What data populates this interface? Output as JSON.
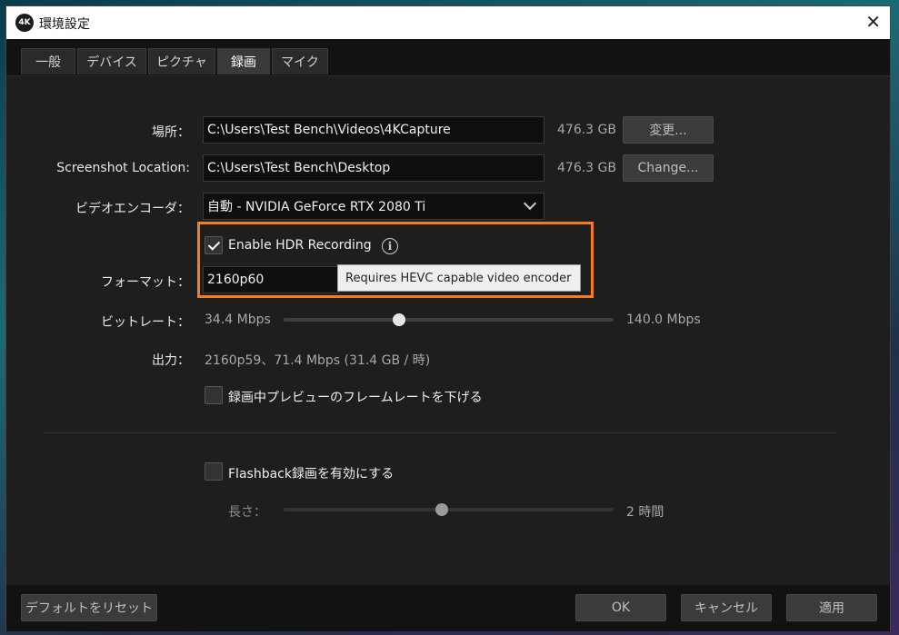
{
  "window": {
    "title": "環境設定",
    "app_icon_text": "4K",
    "close_glyph": "✕"
  },
  "tabs": [
    {
      "label": "一般"
    },
    {
      "label": "デバイス"
    },
    {
      "label": "ピクチャ"
    },
    {
      "label": "録画"
    },
    {
      "label": "マイク"
    }
  ],
  "active_tab": "録画",
  "location": {
    "label": "場所：",
    "value": "C:\\Users\\Test Bench\\Videos\\4KCapture",
    "size": "476.3 GB",
    "button": "変更..."
  },
  "screenshot": {
    "label": "Screenshot Location:",
    "value": "C:\\Users\\Test Bench\\Desktop",
    "size": "476.3 GB",
    "button": "Change..."
  },
  "encoder": {
    "label": "ビデオエンコーダ：",
    "value": "自動 - NVIDIA GeForce RTX 2080 Ti"
  },
  "hdr": {
    "label": "Enable HDR Recording",
    "checked": true,
    "tooltip": "Requires HEVC capable video encoder",
    "highlight_color": "#f57c1f"
  },
  "format": {
    "label": "フォーマット：",
    "value": "2160p60"
  },
  "bitrate": {
    "label": "ビットレート：",
    "min": "34.4 Mbps",
    "max": "140.0 Mbps",
    "position_fraction": 0.35
  },
  "output": {
    "label": "出力：",
    "value": "2160p59、71.4 Mbps (31.4 GB / 時)"
  },
  "preview": {
    "label": "録画中プレビューのフレームレートを下げる",
    "checked": false
  },
  "flashback": {
    "label": "Flashback録画を有効にする",
    "checked": false
  },
  "length": {
    "label": "長さ：",
    "value": "2 時間",
    "position_fraction": 0.48
  },
  "footer": {
    "reset": "デフォルトをリセット",
    "ok": "OK",
    "cancel": "キャンセル",
    "apply": "適用"
  }
}
